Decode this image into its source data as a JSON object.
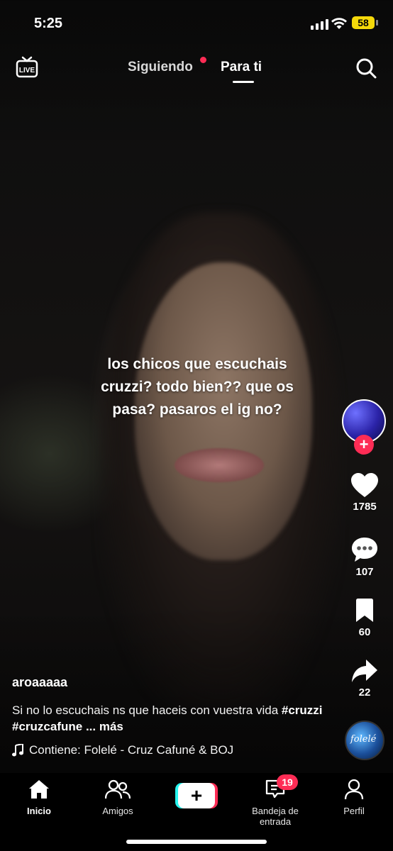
{
  "status_bar": {
    "time": "5:25",
    "battery": "58"
  },
  "header": {
    "live_icon": "live-tv-icon",
    "tabs": [
      {
        "label": "Siguiendo",
        "has_dot": true
      },
      {
        "label": "Para ti",
        "active": true
      }
    ],
    "search_icon": "search-icon"
  },
  "video": {
    "overlay_text": "los chicos que escuchais\ncruzzi? todo bien?? que os\npasa? pasaros el ig no?"
  },
  "actions": {
    "likes": "1785",
    "comments": "107",
    "saves": "60",
    "shares": "22"
  },
  "post": {
    "username": "aroaaaaa",
    "description": "Si no lo escuchais ns que haceis con vuestra vida ",
    "hashtags": [
      "#cruzzi",
      "#cruzcafune"
    ],
    "more": "... más",
    "music": "Contiene: Folelé - Cruz Cafuné & BOJ"
  },
  "disc_text": "folelé",
  "tabbar": {
    "home": "Inicio",
    "friends": "Amigos",
    "create": "+",
    "inbox": "Bandeja de entrada",
    "inbox_badge": "19",
    "profile": "Perfil"
  },
  "colors": {
    "accent": "#fe2c55",
    "cyan": "#25f4ee",
    "battery": "#f5d90a"
  }
}
